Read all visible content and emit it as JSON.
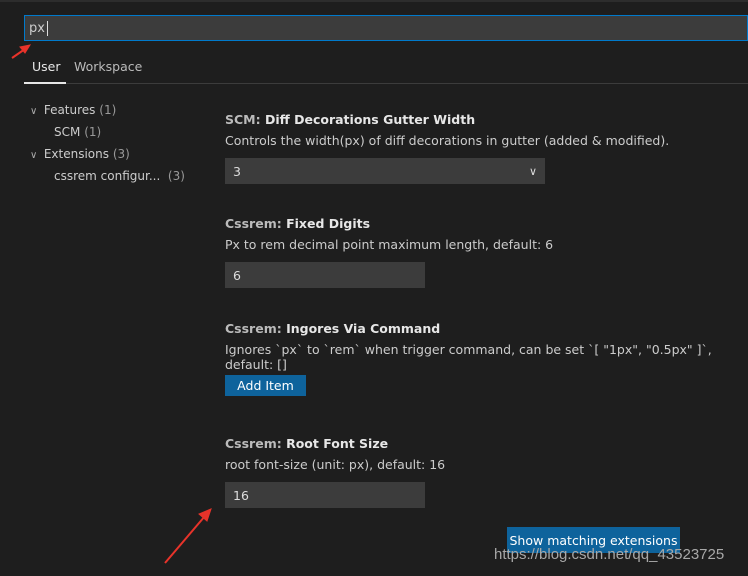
{
  "search": {
    "value": "px"
  },
  "tabs": [
    {
      "label": "User",
      "active": true
    },
    {
      "label": "Workspace",
      "active": false
    }
  ],
  "tree": [
    {
      "label": "Features",
      "count": "(1)"
    },
    {
      "label": "SCM",
      "count": "(1)"
    },
    {
      "label": "Extensions",
      "count": "(3)"
    },
    {
      "label": "cssrem configur...",
      "count": "(3)"
    }
  ],
  "settings": [
    {
      "category": "SCM: ",
      "name": "Diff Decorations Gutter Width",
      "description": "Controls the width(px) of diff decorations in gutter (added & modified).",
      "value": "3"
    },
    {
      "category": "Cssrem: ",
      "name": "Fixed Digits",
      "description": "Px to rem decimal point maximum length, default: 6",
      "value": "6"
    },
    {
      "category": "Cssrem: ",
      "name": "Ingores Via Command",
      "description": "Ignores `px` to `rem` when trigger command, can be set `[ \"1px\", \"0.5px\" ]`, default: []",
      "button": "Add Item"
    },
    {
      "category": "Cssrem: ",
      "name": "Root Font Size",
      "description": "root font-size (unit: px), default: 16",
      "value": "16"
    }
  ],
  "show_extensions": "Show matching extensions",
  "watermark": "https://blog.csdn.net/qq_43523725",
  "colors": {
    "accent": "#007acc",
    "button": "#0e639c",
    "arrow": "#e8332a",
    "background": "#1e1e1e"
  }
}
